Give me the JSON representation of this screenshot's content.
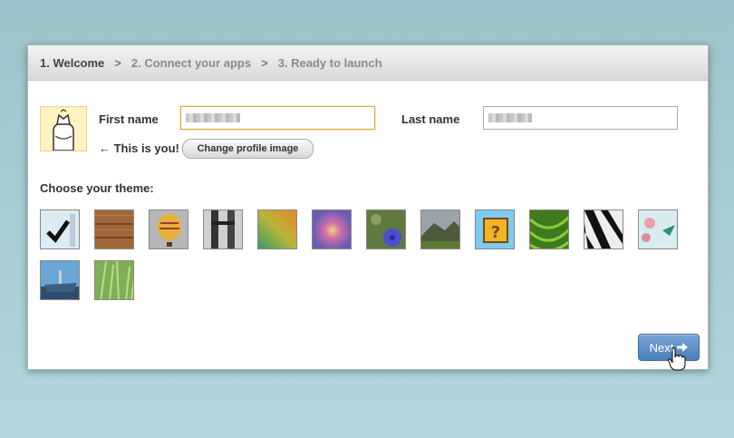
{
  "steps": [
    {
      "label": "1. Welcome"
    },
    {
      "label": "2. Connect your apps"
    },
    {
      "label": "3. Ready to launch"
    }
  ],
  "step_separator": ">",
  "profile": {
    "first_name_label": "First name",
    "last_name_label": "Last name",
    "this_is_you": "← This is you!",
    "change_image_label": "Change profile image"
  },
  "theme": {
    "title": "Choose your theme:",
    "items": [
      {
        "name": "default-checkmark",
        "selected": true
      },
      {
        "name": "wood"
      },
      {
        "name": "hot-air-balloon"
      },
      {
        "name": "bridge"
      },
      {
        "name": "colorful-gradient"
      },
      {
        "name": "swirl"
      },
      {
        "name": "blue-flower"
      },
      {
        "name": "mountains"
      },
      {
        "name": "question-block"
      },
      {
        "name": "green-leaf"
      },
      {
        "name": "zebra"
      },
      {
        "name": "hummingbird"
      },
      {
        "name": "boat"
      },
      {
        "name": "grass"
      }
    ]
  },
  "next_label": "Next",
  "colors": {
    "accent": "#4a7fbb",
    "focus_border": "#d9a63a"
  }
}
